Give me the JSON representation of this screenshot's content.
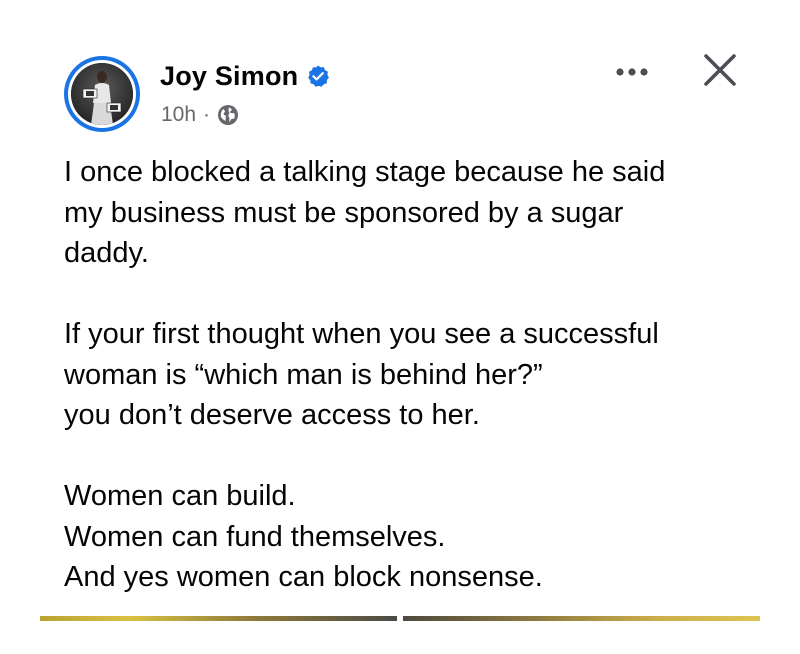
{
  "post": {
    "author": {
      "name": "Joy Simon",
      "verified": true
    },
    "meta": {
      "time": "10h",
      "separator": "·",
      "audience_icon": "globe-icon"
    },
    "actions": {
      "more_icon": "more-horizontal-icon",
      "close_icon": "close-icon"
    },
    "body": {
      "p1_l1": "I once blocked a talking stage because he said",
      "p1_l2": "my business must be sponsored by a sugar",
      "p1_l3": "daddy.",
      "p2_l1": "If your first thought when you see a successful",
      "p2_l2": "woman is “which man is behind her?”",
      "p2_l3": "you don’t deserve access to her.",
      "p3_l1": "Women can build.",
      "p3_l2": "Women can fund themselves.",
      "p3_l3": "And yes women can block nonsense."
    },
    "colors": {
      "verified_blue": "#1b74e4",
      "avatar_ring": "#1b74e4",
      "meta_gray": "#65676b",
      "text": "#050505"
    }
  }
}
